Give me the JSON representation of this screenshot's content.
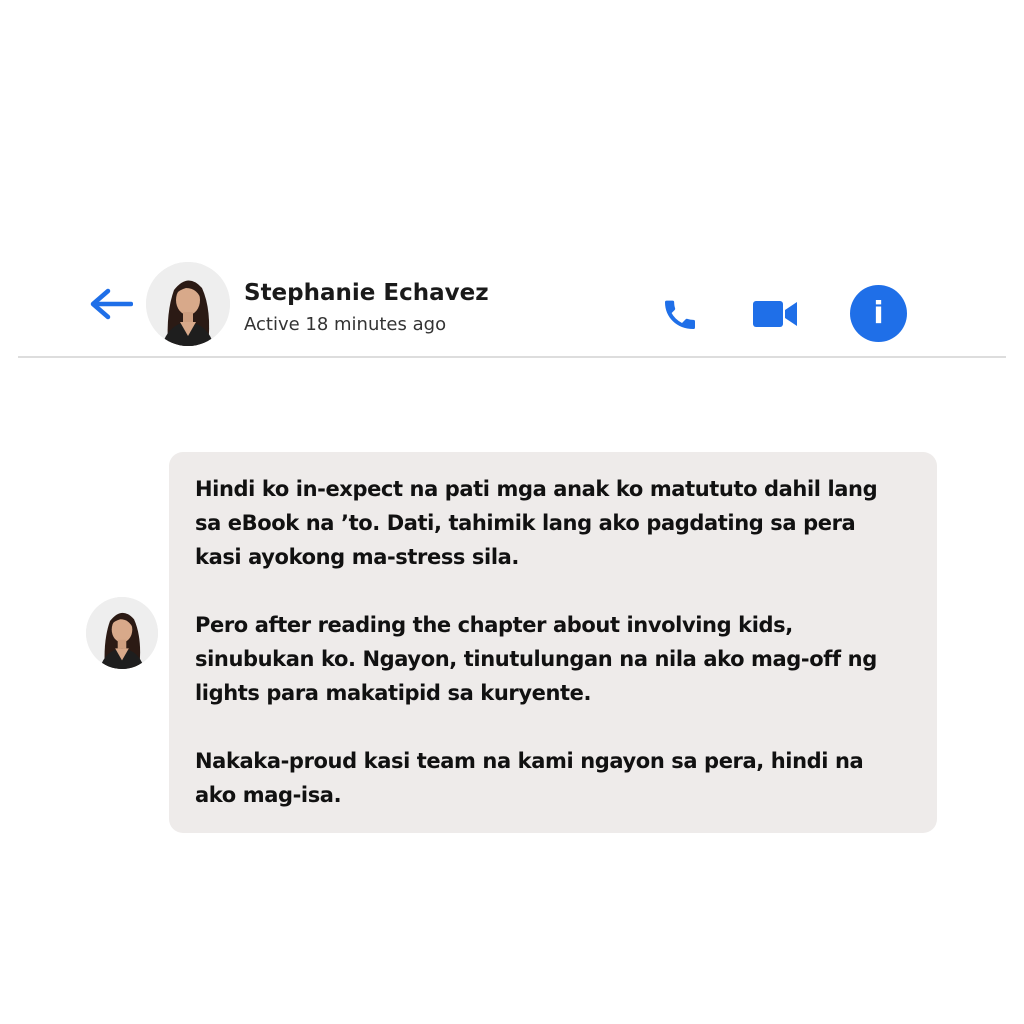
{
  "header": {
    "back_icon": "arrow-left-icon",
    "contact_name": "Stephanie Echavez",
    "contact_status": "Active 18 minutes ago",
    "call_icon": "phone-icon",
    "video_icon": "video-camera-icon",
    "info_icon": "info-icon",
    "info_glyph": "i"
  },
  "message": {
    "paragraphs": [
      "Hindi ko in-expect na pati mga anak ko matututo dahil lang sa eBook na ’to. Dati, tahimik lang ako pagdating sa pera kasi ayokong ma-stress sila.",
      "Pero after reading the chapter about involving kids, sinubukan ko. Ngayon, tinutulungan na nila ako mag-off ng lights para makatipid sa kuryente.",
      "Nakaka-proud kasi team na kami ngayon sa pera, hindi na ako mag-isa."
    ]
  },
  "colors": {
    "accent": "#1f6fe8",
    "bubble_bg": "#eeebea",
    "divider": "#dddddd"
  }
}
